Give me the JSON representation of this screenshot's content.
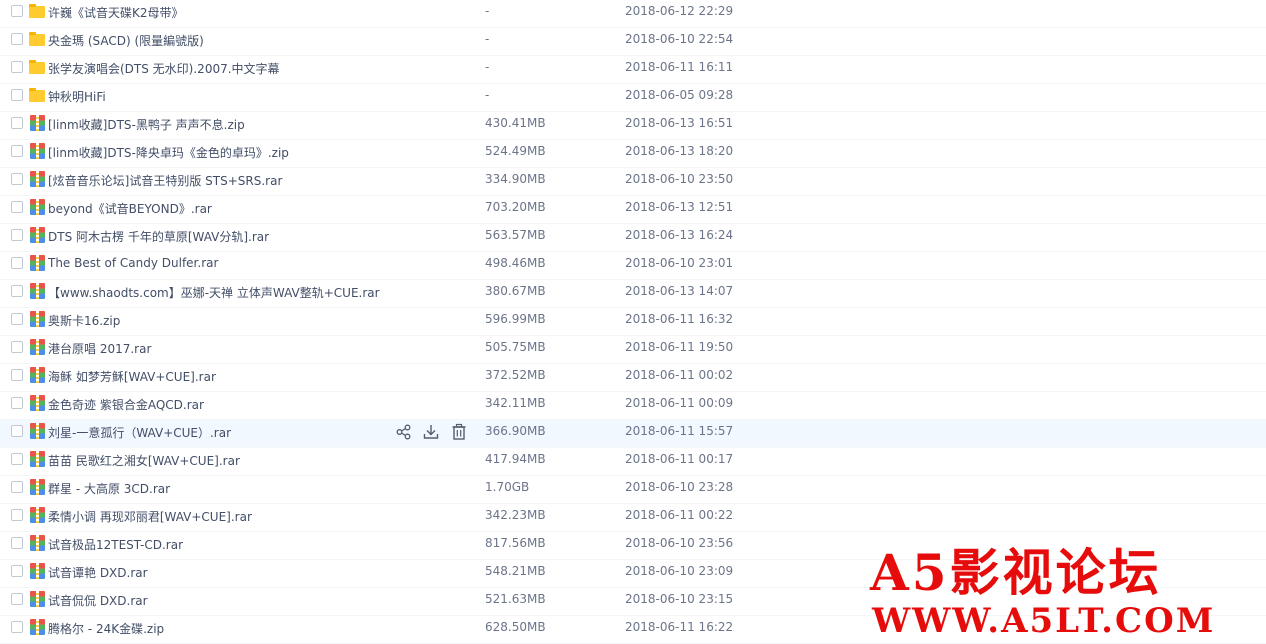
{
  "files": [
    {
      "type": "folder",
      "name": "许巍《试音天碟K2母带》",
      "size": "-",
      "date": "2018-06-12 22:29"
    },
    {
      "type": "folder",
      "name": "央金瑪 (SACD) (限量編號版)",
      "size": "-",
      "date": "2018-06-10 22:54"
    },
    {
      "type": "folder",
      "name": "张学友演唱会(DTS 无水印).2007.中文字幕",
      "size": "-",
      "date": "2018-06-11 16:11"
    },
    {
      "type": "folder",
      "name": "钟秋明HiFi",
      "size": "-",
      "date": "2018-06-05 09:28"
    },
    {
      "type": "archive",
      "name": "[linm收藏]DTS-黑鸭子 声声不息.zip",
      "size": "430.41MB",
      "date": "2018-06-13 16:51"
    },
    {
      "type": "archive",
      "name": "[linm收藏]DTS-降央卓玛《金色的卓玛》.zip",
      "size": "524.49MB",
      "date": "2018-06-13 18:20"
    },
    {
      "type": "archive",
      "name": "[炫音音乐论坛]试音王特别版 STS+SRS.rar",
      "size": "334.90MB",
      "date": "2018-06-10 23:50"
    },
    {
      "type": "archive",
      "name": "beyond《试音BEYOND》.rar",
      "size": "703.20MB",
      "date": "2018-06-13 12:51"
    },
    {
      "type": "archive",
      "name": "DTS 阿木古楞 千年的草原[WAV分轨].rar",
      "size": "563.57MB",
      "date": "2018-06-13 16:24"
    },
    {
      "type": "archive",
      "name": "The Best of Candy Dulfer.rar",
      "size": "498.46MB",
      "date": "2018-06-10 23:01"
    },
    {
      "type": "archive",
      "name": "【www.shaodts.com】巫娜-天禅 立体声WAV整轨+CUE.rar",
      "size": "380.67MB",
      "date": "2018-06-13 14:07"
    },
    {
      "type": "archive",
      "name": "奥斯卡16.zip",
      "size": "596.99MB",
      "date": "2018-06-11 16:32"
    },
    {
      "type": "archive",
      "name": "港台原唱  2017.rar",
      "size": "505.75MB",
      "date": "2018-06-11 19:50"
    },
    {
      "type": "archive",
      "name": "海稣 如梦芳稣[WAV+CUE].rar",
      "size": "372.52MB",
      "date": "2018-06-11 00:02"
    },
    {
      "type": "archive",
      "name": "金色奇迹 紫银合金AQCD.rar",
      "size": "342.11MB",
      "date": "2018-06-11 00:09"
    },
    {
      "type": "archive",
      "name": "刘星-一意孤行（WAV+CUE）.rar",
      "size": "366.90MB",
      "date": "2018-06-11 15:57",
      "hovered": true
    },
    {
      "type": "archive",
      "name": "苗苗 民歌红之湘女[WAV+CUE].rar",
      "size": "417.94MB",
      "date": "2018-06-11 00:17"
    },
    {
      "type": "archive",
      "name": "群星 - 大高原 3CD.rar",
      "size": "1.70GB",
      "date": "2018-06-10 23:28"
    },
    {
      "type": "archive",
      "name": "柔情小调 再现邓丽君[WAV+CUE].rar",
      "size": "342.23MB",
      "date": "2018-06-11 00:22"
    },
    {
      "type": "archive",
      "name": "试音极品12TEST-CD.rar",
      "size": "817.56MB",
      "date": "2018-06-10 23:56"
    },
    {
      "type": "archive",
      "name": "试音谭艳 DXD.rar",
      "size": "548.21MB",
      "date": "2018-06-10 23:09"
    },
    {
      "type": "archive",
      "name": "试音侃侃 DXD.rar",
      "size": "521.63MB",
      "date": "2018-06-10 23:15"
    },
    {
      "type": "archive",
      "name": "腾格尔 - 24K金碟.zip",
      "size": "628.50MB",
      "date": "2018-06-11 16:22"
    }
  ],
  "row_actions": {
    "share_icon": "share-icon",
    "download_icon": "download-icon",
    "delete_icon": "trash-icon"
  },
  "watermark": {
    "title": "A5影视论坛",
    "url": "WWW.A5LT.COM"
  },
  "colors": {
    "text": "#424e67",
    "meta_text": "#6b7489",
    "hover_row": "#f2f8ff",
    "folder": "#ffcb2f",
    "watermark": "#e60c0c"
  }
}
